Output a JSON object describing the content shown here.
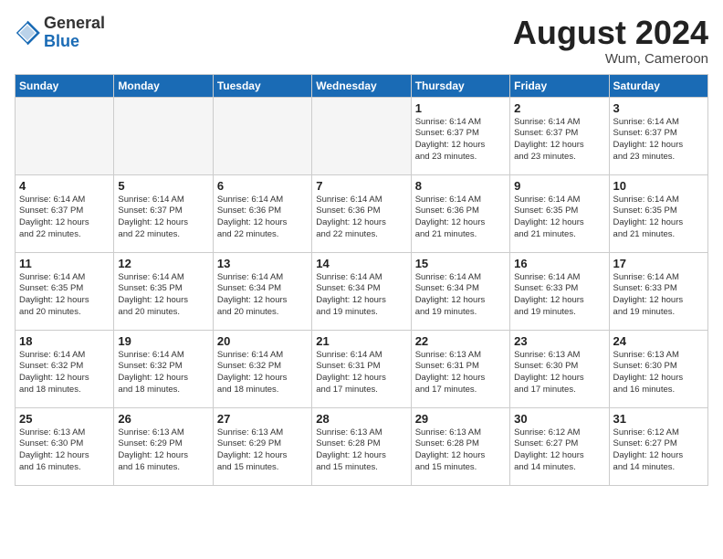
{
  "header": {
    "logo_general": "General",
    "logo_blue": "Blue",
    "title": "August 2024",
    "subtitle": "Wum, Cameroon"
  },
  "days_of_week": [
    "Sunday",
    "Monday",
    "Tuesday",
    "Wednesday",
    "Thursday",
    "Friday",
    "Saturday"
  ],
  "weeks": [
    [
      {
        "num": "",
        "info": ""
      },
      {
        "num": "",
        "info": ""
      },
      {
        "num": "",
        "info": ""
      },
      {
        "num": "",
        "info": ""
      },
      {
        "num": "1",
        "info": "Sunrise: 6:14 AM\nSunset: 6:37 PM\nDaylight: 12 hours\nand 23 minutes."
      },
      {
        "num": "2",
        "info": "Sunrise: 6:14 AM\nSunset: 6:37 PM\nDaylight: 12 hours\nand 23 minutes."
      },
      {
        "num": "3",
        "info": "Sunrise: 6:14 AM\nSunset: 6:37 PM\nDaylight: 12 hours\nand 23 minutes."
      }
    ],
    [
      {
        "num": "4",
        "info": "Sunrise: 6:14 AM\nSunset: 6:37 PM\nDaylight: 12 hours\nand 22 minutes."
      },
      {
        "num": "5",
        "info": "Sunrise: 6:14 AM\nSunset: 6:37 PM\nDaylight: 12 hours\nand 22 minutes."
      },
      {
        "num": "6",
        "info": "Sunrise: 6:14 AM\nSunset: 6:36 PM\nDaylight: 12 hours\nand 22 minutes."
      },
      {
        "num": "7",
        "info": "Sunrise: 6:14 AM\nSunset: 6:36 PM\nDaylight: 12 hours\nand 22 minutes."
      },
      {
        "num": "8",
        "info": "Sunrise: 6:14 AM\nSunset: 6:36 PM\nDaylight: 12 hours\nand 21 minutes."
      },
      {
        "num": "9",
        "info": "Sunrise: 6:14 AM\nSunset: 6:35 PM\nDaylight: 12 hours\nand 21 minutes."
      },
      {
        "num": "10",
        "info": "Sunrise: 6:14 AM\nSunset: 6:35 PM\nDaylight: 12 hours\nand 21 minutes."
      }
    ],
    [
      {
        "num": "11",
        "info": "Sunrise: 6:14 AM\nSunset: 6:35 PM\nDaylight: 12 hours\nand 20 minutes."
      },
      {
        "num": "12",
        "info": "Sunrise: 6:14 AM\nSunset: 6:35 PM\nDaylight: 12 hours\nand 20 minutes."
      },
      {
        "num": "13",
        "info": "Sunrise: 6:14 AM\nSunset: 6:34 PM\nDaylight: 12 hours\nand 20 minutes."
      },
      {
        "num": "14",
        "info": "Sunrise: 6:14 AM\nSunset: 6:34 PM\nDaylight: 12 hours\nand 19 minutes."
      },
      {
        "num": "15",
        "info": "Sunrise: 6:14 AM\nSunset: 6:34 PM\nDaylight: 12 hours\nand 19 minutes."
      },
      {
        "num": "16",
        "info": "Sunrise: 6:14 AM\nSunset: 6:33 PM\nDaylight: 12 hours\nand 19 minutes."
      },
      {
        "num": "17",
        "info": "Sunrise: 6:14 AM\nSunset: 6:33 PM\nDaylight: 12 hours\nand 19 minutes."
      }
    ],
    [
      {
        "num": "18",
        "info": "Sunrise: 6:14 AM\nSunset: 6:32 PM\nDaylight: 12 hours\nand 18 minutes."
      },
      {
        "num": "19",
        "info": "Sunrise: 6:14 AM\nSunset: 6:32 PM\nDaylight: 12 hours\nand 18 minutes."
      },
      {
        "num": "20",
        "info": "Sunrise: 6:14 AM\nSunset: 6:32 PM\nDaylight: 12 hours\nand 18 minutes."
      },
      {
        "num": "21",
        "info": "Sunrise: 6:14 AM\nSunset: 6:31 PM\nDaylight: 12 hours\nand 17 minutes."
      },
      {
        "num": "22",
        "info": "Sunrise: 6:13 AM\nSunset: 6:31 PM\nDaylight: 12 hours\nand 17 minutes."
      },
      {
        "num": "23",
        "info": "Sunrise: 6:13 AM\nSunset: 6:30 PM\nDaylight: 12 hours\nand 17 minutes."
      },
      {
        "num": "24",
        "info": "Sunrise: 6:13 AM\nSunset: 6:30 PM\nDaylight: 12 hours\nand 16 minutes."
      }
    ],
    [
      {
        "num": "25",
        "info": "Sunrise: 6:13 AM\nSunset: 6:30 PM\nDaylight: 12 hours\nand 16 minutes."
      },
      {
        "num": "26",
        "info": "Sunrise: 6:13 AM\nSunset: 6:29 PM\nDaylight: 12 hours\nand 16 minutes."
      },
      {
        "num": "27",
        "info": "Sunrise: 6:13 AM\nSunset: 6:29 PM\nDaylight: 12 hours\nand 15 minutes."
      },
      {
        "num": "28",
        "info": "Sunrise: 6:13 AM\nSunset: 6:28 PM\nDaylight: 12 hours\nand 15 minutes."
      },
      {
        "num": "29",
        "info": "Sunrise: 6:13 AM\nSunset: 6:28 PM\nDaylight: 12 hours\nand 15 minutes."
      },
      {
        "num": "30",
        "info": "Sunrise: 6:12 AM\nSunset: 6:27 PM\nDaylight: 12 hours\nand 14 minutes."
      },
      {
        "num": "31",
        "info": "Sunrise: 6:12 AM\nSunset: 6:27 PM\nDaylight: 12 hours\nand 14 minutes."
      }
    ]
  ]
}
